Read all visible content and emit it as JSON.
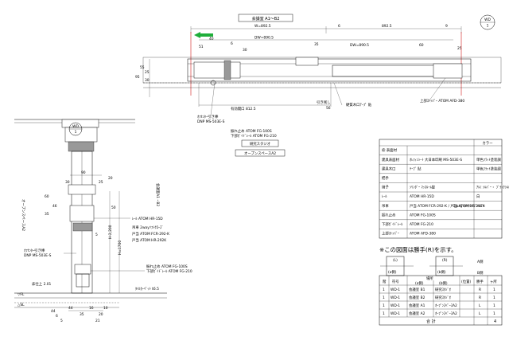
{
  "header": {
    "room_title": "会議室 A1～B2",
    "sheet_no_top": "WD",
    "sheet_no_bottom": "1"
  },
  "plan": {
    "w_total": "W=892.5",
    "w_right": "892.5",
    "dw_left": "DW=890.5",
    "dw_right": "DW=890.5",
    "d51": "51",
    "d6": "6",
    "d6b": "6",
    "d9": "9",
    "d60": "60",
    "d40": "40",
    "d30": "30",
    "d35": "35",
    "d25": "25",
    "v25": "25",
    "v30": "30",
    "v55": "55",
    "v95": "95",
    "opening": "有効開口 812.5",
    "pull_margin": "引き残し",
    "pull_val": "56",
    "plan_notes": [
      "ｵﾌｾﾝﾀｰ引き棒",
      "DNP MS-503E-S",
      "振れ止め ATOM FG-100S",
      "下部ｶﾞｲﾄﾞﾚｰﾙ ATOM FG-210"
    ],
    "frame_note": "硬質木口ﾃｰﾌﾟ 貼",
    "upper_stopper": "上部ｽﾄｯﾊﾟｰ ATOM AFD-380",
    "room_left": "研究スタジオ",
    "room_right": "オープンスペースA2"
  },
  "section": {
    "label_left": "オープンスペースA2",
    "label_right": "会議室A1・B2",
    "sheet_no_top": "WD",
    "sheet_no_bottom": "1",
    "dim_top": "90",
    "dim_a": "30",
    "dim_b": "25",
    "dim_c": "20",
    "dim_d": "60",
    "dim_e": "35",
    "dim_f": "46",
    "dim_g": "50",
    "dim_h": "H=1700",
    "dim_i": "H-2,200",
    "dim_j": "5",
    "dim_k": "44",
    "dim_l": "35",
    "dim_m": "16",
    "dim_n": "20",
    "dim_o": "10",
    "dim_p": "21",
    "rail_note": "ﾚｰﾙ ATOM HR-15D",
    "hanger_note": "吊車 2wayｿﾌﾄｸﾛｰｽﾞ",
    "door_stop_left": "戸当 ATOM FCR-292-K",
    "door_stop_right": "戸当 ATOM HR-292K",
    "pull_note_1": "ｵﾌｾﾝﾀｰ引き棒",
    "pull_note_2": "DNP MS-503E-S",
    "guide_note_1": "振れ止め ATOM FG-100S",
    "guide_note_2": "下部ｶﾞｲﾄﾞﾚｰﾙ ATOM FG-210",
    "floor_finish": "床仕上 2.01",
    "fl_label": "▽FL",
    "sl_label": "△SL",
    "tile_note": "ﾀｲﾙｶｰﾍﾟｯﾄ t6.5",
    "f_dims": [
      "44",
      "6",
      "5"
    ]
  },
  "spec_table": {
    "color_header": "カラー",
    "rows": [
      {
        "label": "枠 表面材",
        "value": "",
        "color": ""
      },
      {
        "label": "建具表面材",
        "value": "ｵﾚﾌｨﾝｼｰﾄ 大日本印刷 MS-503E-S",
        "color": "単色ﾌﾗｯﾄ塗装調"
      },
      {
        "label": "建具木口",
        "value": "ﾃｰﾌﾟ 貼",
        "color": "単色ﾌﾗｯﾄ塗装調"
      },
      {
        "label": "把手",
        "value": "",
        "color": ""
      },
      {
        "label": "硝子",
        "value": "ｼﾘﾝﾀﾞｰ ﾏｯｽﾙｰﾑ錠",
        "color": "ｱﾙﾐ ｼﾙﾊﾞｰ・ ﾌﾞﾗｯｸｼﾙﾊﾞｰ"
      },
      {
        "label": "ﾚｰﾙ",
        "value": "ATOM HR-15D",
        "color": "白"
      },
      {
        "label": "吊車",
        "value": "戸当 ATOM FCR-292-K / 戸当 ATOM HR-292K",
        "extra": "2wayｿﾌﾄｸﾛｰｽﾞ",
        "color": "ｼﾙﾊﾞｰ"
      },
      {
        "label": "振れ止め",
        "value": "ATOM FG-100S",
        "color": ""
      },
      {
        "label": "下部ｶﾞｲﾄﾞﾚｰﾙ",
        "value": "ATOM FG-210",
        "color": ""
      },
      {
        "label": "上部ｽﾄｯﾊﾟｰ",
        "value": "ATOM AFD-380",
        "color": ""
      }
    ]
  },
  "hand_note": "※この図面は勝手(R)を示す。",
  "hand_diagram": {
    "l_label": "(L)",
    "r_label": "(R)",
    "a_side": "A側",
    "b_side": "B側",
    "side_a_tag": "(a側)",
    "side_b_tag": "(b側)"
  },
  "schedule": {
    "headers": {
      "no": "階",
      "sym": "符号",
      "place": "場所",
      "place_a": "(a側)",
      "place_b": "(b側)",
      "pos": "(位置)",
      "hand": "勝手",
      "qty": "ヶ所"
    },
    "rows": [
      {
        "floor": "1",
        "sym": "WD-1",
        "a": "会議室 B1",
        "b": "研究ｽﾀｼﾞｵ",
        "pos": "",
        "hand": "R",
        "qty": "1"
      },
      {
        "floor": "1",
        "sym": "WD-1",
        "a": "会議室 B2",
        "b": "研究ｽﾀｼﾞｵ",
        "pos": "",
        "hand": "R",
        "qty": "1"
      },
      {
        "floor": "1",
        "sym": "WD-1",
        "a": "会議室 A1",
        "b": "ｵｰﾌﾟﾝｽﾍﾟｰｽA2",
        "pos": "",
        "hand": "L",
        "qty": "1"
      },
      {
        "floor": "1",
        "sym": "WD-1",
        "a": "会議室 A2",
        "b": "ｵｰﾌﾟﾝｽﾍﾟｰｽA2",
        "pos": "",
        "hand": "L",
        "qty": "1"
      }
    ],
    "total_label": "合 計",
    "total_value": "4"
  }
}
